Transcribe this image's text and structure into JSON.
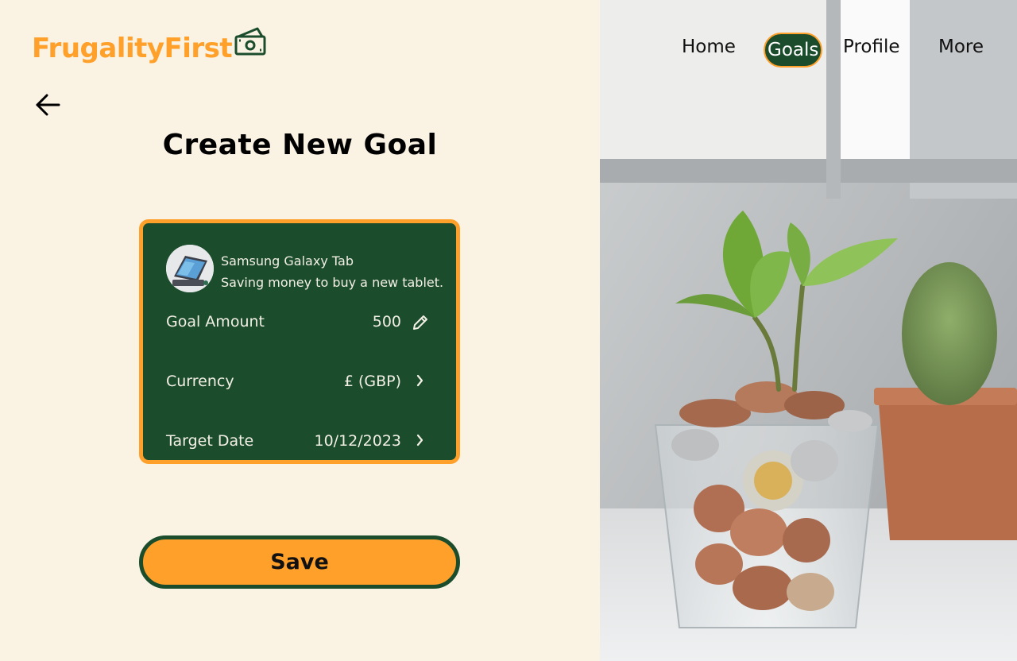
{
  "app": {
    "name": "FrugalityFirst",
    "brand_color": "#ffa02a",
    "accent_color": "#1b4d2d"
  },
  "nav": {
    "items": [
      {
        "label": "Home",
        "active": false
      },
      {
        "label": "Goals",
        "active": true
      },
      {
        "label": "Profile",
        "active": false
      },
      {
        "label": "More",
        "active": false
      }
    ]
  },
  "header": {
    "back_icon": "arrow-left-icon",
    "title": "Create New Goal"
  },
  "goal": {
    "name": "Samsung Galaxy Tab",
    "description": "Saving money to buy a new tablet.",
    "image_icon": "tablet-thumbnail",
    "fields": [
      {
        "label": "Goal Amount",
        "value": "500",
        "icon": "pencil-icon"
      },
      {
        "label": "Currency",
        "value": "£ (GBP)",
        "icon": "chevron-right-icon"
      },
      {
        "label": "Target Date",
        "value": "10/12/2023",
        "icon": "chevron-right-icon"
      }
    ]
  },
  "actions": {
    "save_label": "Save"
  }
}
